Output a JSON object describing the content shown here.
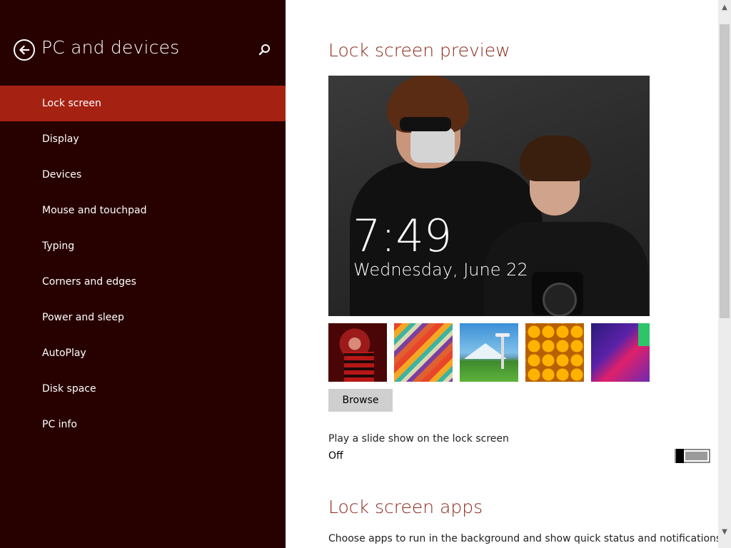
{
  "sidebar": {
    "title": "PC and devices",
    "back_icon": "back-arrow-icon",
    "search_icon": "search-icon",
    "items": [
      {
        "label": "Lock screen",
        "selected": true
      },
      {
        "label": "Display"
      },
      {
        "label": "Devices"
      },
      {
        "label": "Mouse and touchpad"
      },
      {
        "label": "Typing"
      },
      {
        "label": "Corners and edges"
      },
      {
        "label": "Power and sleep"
      },
      {
        "label": "AutoPlay"
      },
      {
        "label": "Disk space"
      },
      {
        "label": "PC info"
      }
    ]
  },
  "main": {
    "preview_title": "Lock screen preview",
    "preview_time": "7:49",
    "preview_date": "Wednesday, June 22",
    "browse_label": "Browse",
    "slideshow_label": "Play a slide show on the lock screen",
    "slideshow_state": "Off",
    "apps_title": "Lock screen apps",
    "apps_description": "Choose apps to run in the background and show quick status and notifications,"
  },
  "colors": {
    "sidebar_bg": "#270000",
    "selected_bg": "#a52213",
    "accent_title": "#8b2a1c"
  }
}
